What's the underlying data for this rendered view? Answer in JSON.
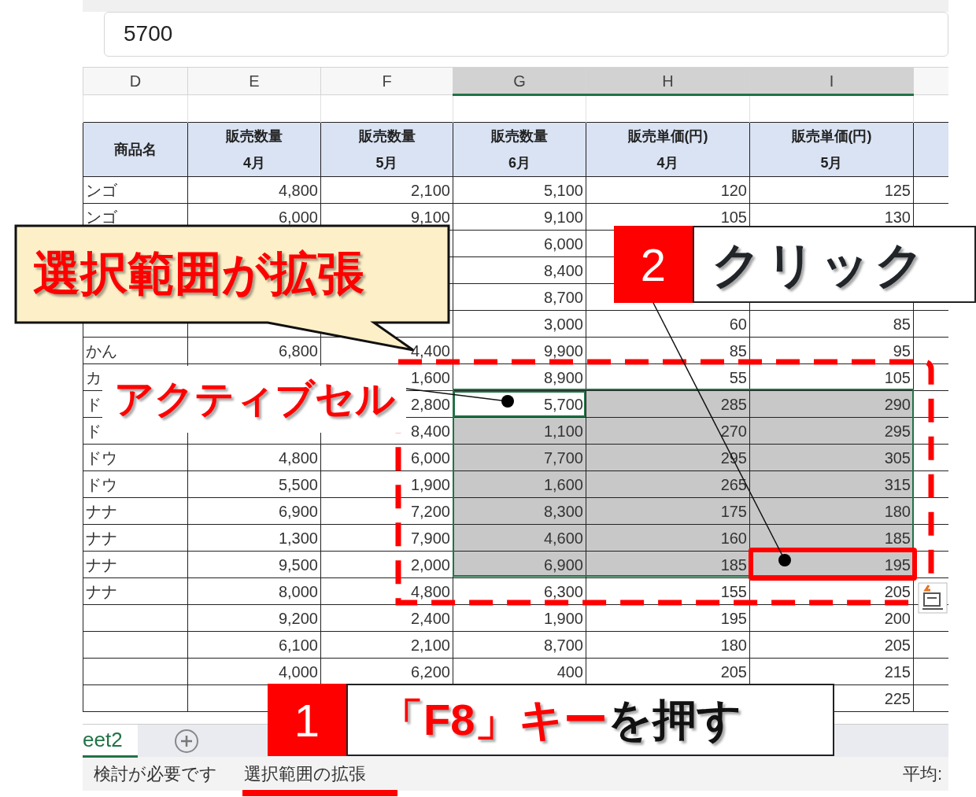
{
  "formula_bar": {
    "value": "5700"
  },
  "column_headers": [
    {
      "label": "D",
      "selected": false
    },
    {
      "label": "E",
      "selected": false
    },
    {
      "label": "F",
      "selected": false
    },
    {
      "label": "G",
      "selected": true
    },
    {
      "label": "H",
      "selected": true
    },
    {
      "label": "I",
      "selected": true
    }
  ],
  "table": {
    "header": [
      {
        "lines": [
          "商品名"
        ]
      },
      {
        "lines": [
          "販売数量",
          "4月"
        ]
      },
      {
        "lines": [
          "販売数量",
          "5月"
        ]
      },
      {
        "lines": [
          "販売数量",
          "6月"
        ]
      },
      {
        "lines": [
          "販売単価(円)",
          "4月"
        ]
      },
      {
        "lines": [
          "販売単価(円)",
          "5月"
        ]
      }
    ],
    "rows": [
      {
        "selected": false,
        "active": false,
        "cells": [
          "ンゴ",
          "4,800",
          "2,100",
          "5,100",
          "120",
          "125"
        ]
      },
      {
        "selected": false,
        "active": false,
        "cells": [
          "ンゴ",
          "6,000",
          "9,100",
          "9,100",
          "105",
          "130"
        ]
      },
      {
        "selected": false,
        "active": false,
        "cells": [
          null,
          null,
          null,
          "6,000",
          null,
          null
        ]
      },
      {
        "selected": false,
        "active": false,
        "cells": [
          null,
          null,
          null,
          "8,400",
          null,
          null
        ]
      },
      {
        "selected": false,
        "active": false,
        "cells": [
          null,
          null,
          null,
          "8,700",
          null,
          null
        ]
      },
      {
        "selected": false,
        "active": false,
        "cells": [
          null,
          null,
          null,
          "3,000",
          "60",
          "85"
        ]
      },
      {
        "selected": false,
        "active": false,
        "cells": [
          "かん",
          "6,800",
          "4,400",
          "9,900",
          "85",
          "95"
        ]
      },
      {
        "selected": false,
        "active": false,
        "cells": [
          "カ",
          null,
          "1,600",
          "8,900",
          "55",
          "105"
        ]
      },
      {
        "selected": true,
        "active": true,
        "cells": [
          "ド",
          null,
          "2,800",
          "5,700",
          "285",
          "290"
        ]
      },
      {
        "selected": true,
        "active": false,
        "cells": [
          "ド",
          null,
          "8,400",
          "1,100",
          "270",
          "295"
        ]
      },
      {
        "selected": true,
        "active": false,
        "cells": [
          "ドウ",
          "4,800",
          "6,000",
          "7,700",
          "295",
          "305"
        ]
      },
      {
        "selected": true,
        "active": false,
        "cells": [
          "ドウ",
          "5,500",
          "1,900",
          "1,600",
          "265",
          "315"
        ]
      },
      {
        "selected": true,
        "active": false,
        "cells": [
          "ナナ",
          "6,900",
          "7,200",
          "8,300",
          "175",
          "180"
        ]
      },
      {
        "selected": true,
        "active": false,
        "cells": [
          "ナナ",
          "1,300",
          "7,900",
          "4,600",
          "160",
          "185"
        ]
      },
      {
        "selected": true,
        "active": false,
        "cells": [
          "ナナ",
          "9,500",
          "2,000",
          "6,900",
          "185",
          "195"
        ]
      },
      {
        "selected": false,
        "active": false,
        "cells": [
          "ナナ",
          "8,000",
          "4,800",
          "6,300",
          "155",
          "205"
        ]
      },
      {
        "selected": false,
        "active": false,
        "cells": [
          null,
          "9,200",
          "2,400",
          "1,900",
          "195",
          "200"
        ]
      },
      {
        "selected": false,
        "active": false,
        "cells": [
          null,
          "6,100",
          "2,100",
          "8,700",
          "180",
          "205"
        ]
      },
      {
        "selected": false,
        "active": false,
        "cells": [
          null,
          "4,000",
          "6,200",
          "400",
          "205",
          "215"
        ]
      },
      {
        "selected": false,
        "active": false,
        "cells": [
          null,
          null,
          null,
          null,
          null,
          "225"
        ]
      }
    ]
  },
  "sheet_tabs": [
    {
      "label": "eet2",
      "selected": true
    }
  ],
  "status_bar": {
    "left": "検討が必要です",
    "mode": "選択範囲の拡張",
    "right": "平均:"
  },
  "annotations": {
    "callout": "選択範囲が拡張",
    "step2": {
      "number": "2",
      "text": "クリック"
    },
    "active_cell_label": "アクティブセル",
    "step1": {
      "number": "1",
      "key": "「F8」キー",
      "text": "を押す"
    }
  }
}
